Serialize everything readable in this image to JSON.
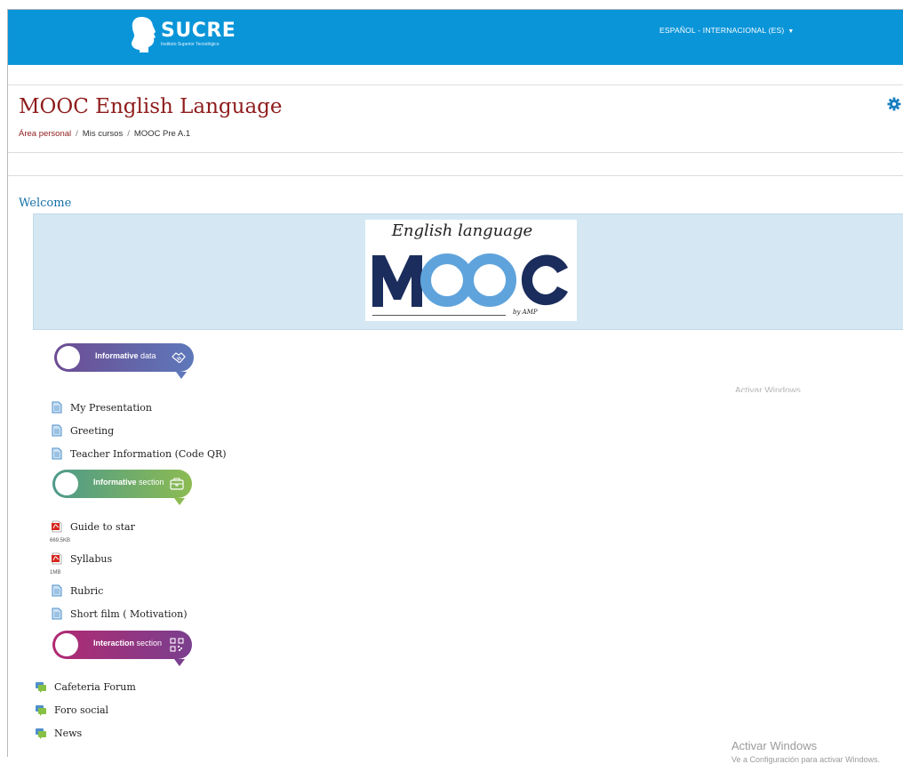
{
  "header": {
    "logo_title": "SUCRE",
    "logo_subtitle": "Instituto Superior Tecnológico",
    "language": "ESPAÑOL - INTERNACIONAL (ES)",
    "accent_color": "#0a95d9"
  },
  "page": {
    "title": "MOOC English Language",
    "breadcrumb": [
      "Área personal",
      "Mis cursos",
      "MOOC Pre A.1"
    ]
  },
  "course": {
    "section_title": "Welcome",
    "banner": {
      "heading": "English language",
      "logo_text": "MOOC",
      "byline": "by AMP"
    }
  },
  "sections": [
    {
      "label_bold": "Informative",
      "label_rest": " data",
      "icon": "handshake-icon",
      "color": "#6b74b8"
    },
    {
      "label_bold": "Informative",
      "label_rest": " section",
      "icon": "briefcase-icon",
      "color": "#7fb25a"
    },
    {
      "label_bold": "Interaction",
      "label_rest": " section",
      "icon": "qr-code-icon",
      "color": "#9c2f7c"
    }
  ],
  "activities_1": [
    {
      "name": "My Presentation",
      "icon": "page-icon"
    },
    {
      "name": "Greeting",
      "icon": "page-icon"
    },
    {
      "name": "Teacher Information (Code QR)",
      "icon": "page-icon"
    }
  ],
  "activities_2": [
    {
      "name": "Guide to star",
      "icon": "pdf-icon",
      "size": "669.5KB"
    },
    {
      "name": "Syllabus",
      "icon": "pdf-icon",
      "size": "1MB"
    },
    {
      "name": "Rubric",
      "icon": "page-icon"
    },
    {
      "name": "Short film ( Motivation)",
      "icon": "page-icon"
    }
  ],
  "activities_3": [
    {
      "name": "Cafeteria Forum",
      "icon": "forum-icon"
    },
    {
      "name": "Foro social",
      "icon": "forum-icon"
    },
    {
      "name": "News",
      "icon": "forum-icon"
    }
  ],
  "watermark": {
    "top_partial": "Activar Windows",
    "line1": "Activar Windows",
    "line2": "Ve a Configuración para activar Windows."
  }
}
